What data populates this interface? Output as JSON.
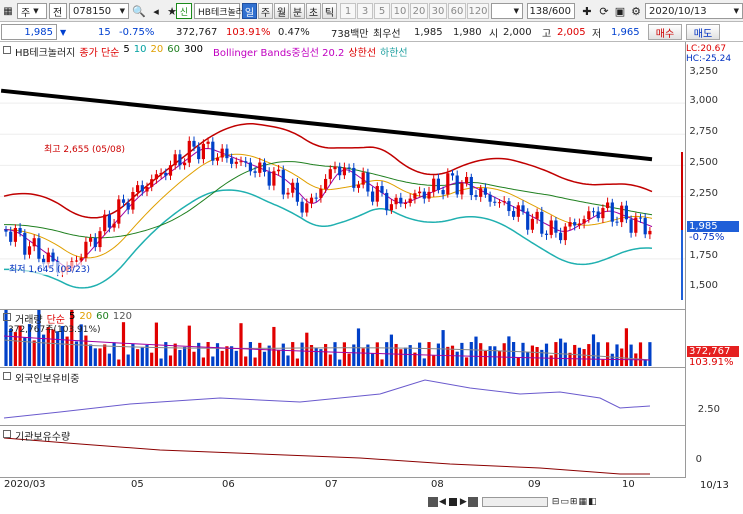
{
  "toolbar": {
    "market": "주",
    "market_type": "전",
    "code": "078150",
    "stock_type_badge": "신",
    "stock_name": "HB테크놀러",
    "period_tabs": [
      "일",
      "주",
      "월",
      "분",
      "초",
      "틱"
    ],
    "number_buttons": [
      "1",
      "3",
      "5",
      "10",
      "20",
      "30",
      "60",
      "120"
    ],
    "count_value": "138",
    "count_total": "/600",
    "date": "2020/10/13"
  },
  "quote": {
    "price": "1,985",
    "change": "15",
    "change_pct": "-0.75%",
    "volume": "372,767",
    "volume_ratio": "103.91%",
    "turnover_pct": "0.47%",
    "amount": "738백만",
    "bid_label": "최우선",
    "bid_ask1": "1,985",
    "bid_ask2": "1,980",
    "open_label": "시",
    "open": "2,000",
    "high_label": "고",
    "high": "2,005",
    "low_label": "저",
    "low": "1,965",
    "buy_label": "매수",
    "sell_label": "매도"
  },
  "price_panel": {
    "legend_name": "HB테크놀러지",
    "ma_label": "종가 단순",
    "ma_periods": [
      "5",
      "10",
      "20",
      "60",
      "300"
    ],
    "bb_label": "Bollinger Bands중심선 20.2",
    "bb_upper": "상한선",
    "bb_lower": "하한선",
    "high_annotation": "최고 2,655 (05/08)",
    "low_annotation": "최저 1,645 (03/23)",
    "lc_label": "LC:20.67",
    "hc_label": "HC:-25.24",
    "y_ticks": [
      "3,250",
      "3,000",
      "2,750",
      "2,500",
      "2,250",
      "1,750",
      "1,500"
    ],
    "current_price": "1,985",
    "current_change": "-0.75%"
  },
  "volume_panel": {
    "legend_name": "거래량",
    "ma_label": "단순",
    "ma_periods": [
      "5",
      "20",
      "60",
      "120"
    ],
    "value_text": "372,767주(103.91%)",
    "current": "372,767",
    "ratio": "103.91%"
  },
  "foreign_panel": {
    "legend_name": "외국인보유비중",
    "tick": "2.50"
  },
  "inst_panel": {
    "legend_name": "기관보유수량",
    "tick": "0"
  },
  "x_axis": {
    "labels": [
      "2020/03",
      "05",
      "06",
      "07",
      "08",
      "09",
      "10"
    ],
    "end_label": "10/13"
  },
  "colors": {
    "up": "#e00000",
    "down": "#0040c8",
    "bb_upper": "#c00000",
    "bb_lower": "#20b0b0",
    "ma300": "#000000"
  },
  "chart_data": {
    "type": "candlestick",
    "title": "HB테크놀러지",
    "x_range": [
      "2020/03",
      "2020/10/13"
    ],
    "ylim": [
      1400,
      3350
    ],
    "price_anchor": [
      {
        "x": "2020/03/03",
        "y": 1985
      },
      {
        "x": "2020/03/23",
        "y": 1645
      },
      {
        "x": "2020/04/15",
        "y": 2250
      },
      {
        "x": "2020/05/08",
        "y": 2655
      },
      {
        "x": "2020/06/05",
        "y": 2400
      },
      {
        "x": "2020/06/15",
        "y": 2150
      },
      {
        "x": "2020/06/25",
        "y": 2500
      },
      {
        "x": "2020/07/15",
        "y": 2180
      },
      {
        "x": "2020/08/05",
        "y": 2380
      },
      {
        "x": "2020/08/25",
        "y": 2150
      },
      {
        "x": "2020/09/10",
        "y": 1950
      },
      {
        "x": "2020/09/25",
        "y": 2150
      },
      {
        "x": "2020/10/13",
        "y": 1985
      }
    ],
    "ma300": [
      {
        "x": "2020/03",
        "y": 3100
      },
      {
        "x": "2020/10/13",
        "y": 2550
      }
    ]
  }
}
